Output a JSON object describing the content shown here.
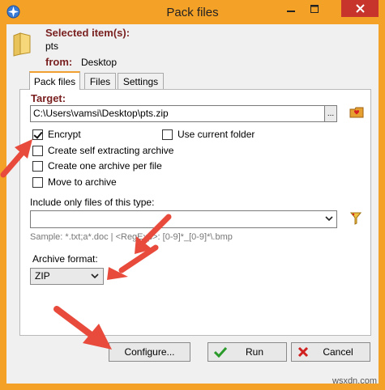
{
  "window": {
    "title": "Pack files",
    "colors": {
      "frame": "#f4a127",
      "close": "#c7342b",
      "label_accent": "#7a2020",
      "arrow": "#e84a3c"
    }
  },
  "selection": {
    "selected_label": "Selected item(s):",
    "selected_value": "pts",
    "from_label": "from:",
    "from_value": "Desktop"
  },
  "tabs": [
    {
      "label": "Pack files",
      "active": true
    },
    {
      "label": "Files",
      "active": false
    },
    {
      "label": "Settings",
      "active": false
    }
  ],
  "pack": {
    "target_label": "Target:",
    "target_value": "C:\\Users\\vamsi\\Desktop\\pts.zip",
    "browse_label": "...",
    "options": {
      "encrypt": {
        "label": "Encrypt",
        "checked": true
      },
      "use_current_folder": {
        "label": "Use current folder",
        "checked": false
      },
      "self_extracting": {
        "label": "Create self extracting archive",
        "checked": false
      },
      "one_archive_per_file": {
        "label": "Create one archive per file",
        "checked": false
      },
      "move_to_archive": {
        "label": "Move to archive",
        "checked": false
      }
    },
    "include_label": "Include only files of this type:",
    "include_value": "",
    "sample_text": "Sample: *.txt;a*.doc | <RegExp>: [0-9]*_[0-9]*\\.bmp",
    "format_label": "Archive format:",
    "format_value": "ZIP"
  },
  "buttons": {
    "configure": "Configure...",
    "run": "Run",
    "cancel": "Cancel"
  },
  "watermark": "wsxdn.com"
}
